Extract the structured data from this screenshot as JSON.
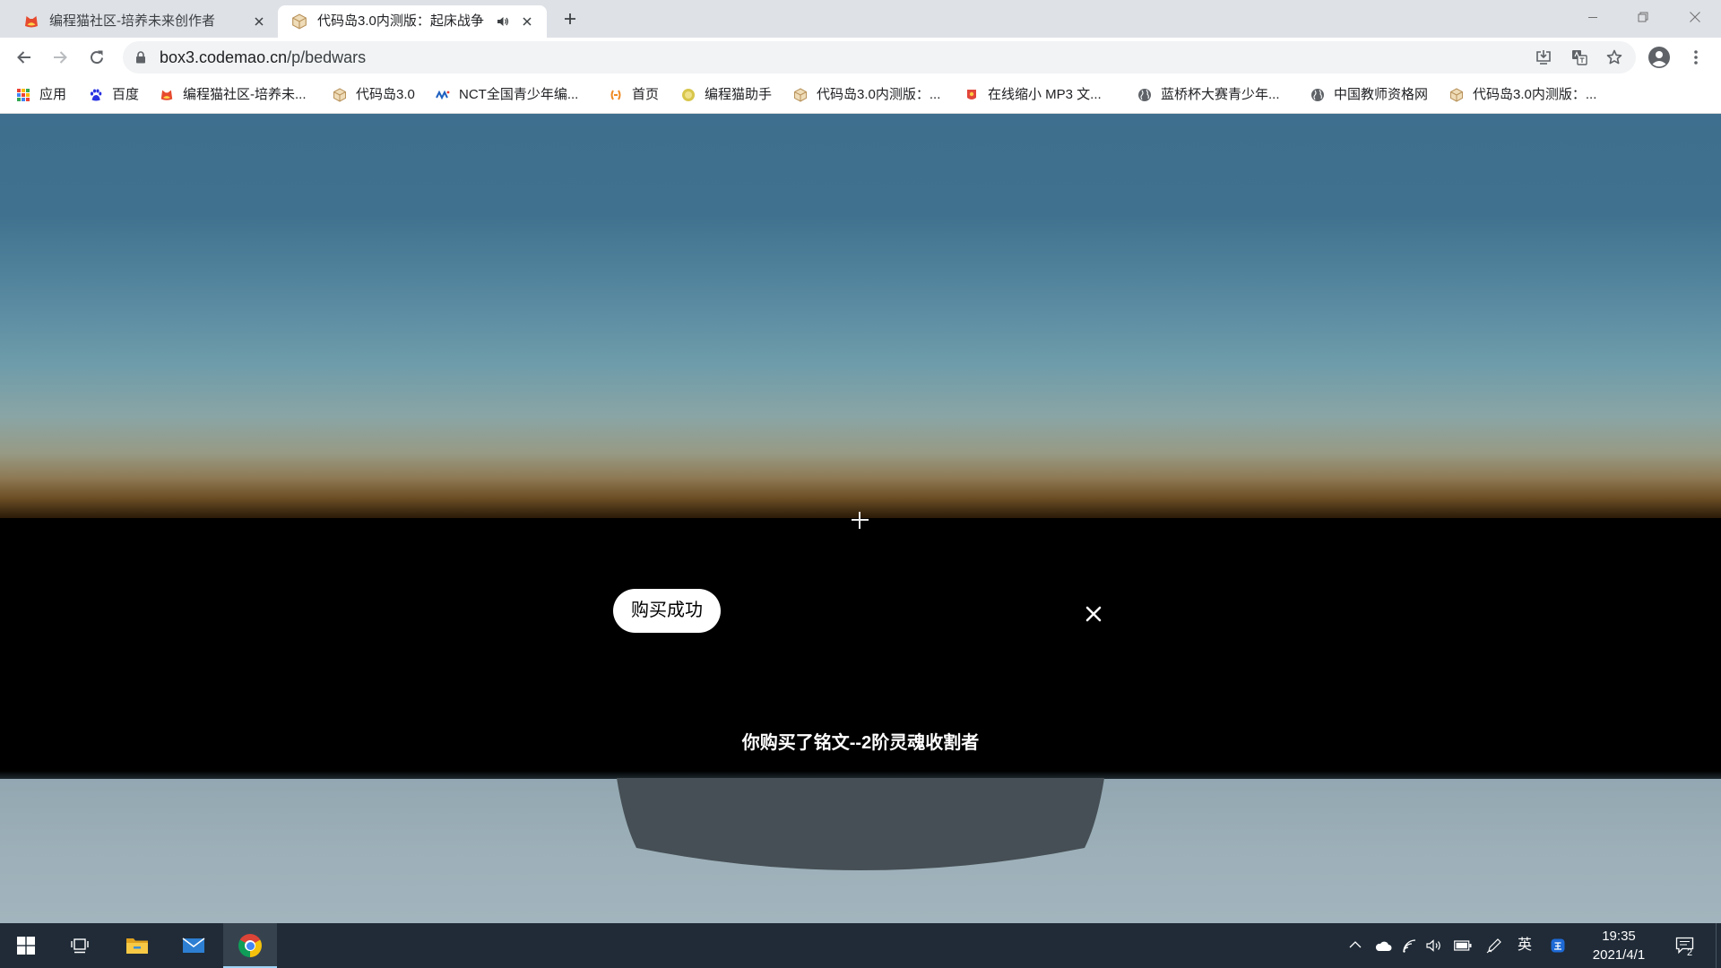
{
  "window": {
    "tabs": [
      {
        "title": "编程猫社区-培养未来创作者",
        "icon": "codemao-icon",
        "close_icon": "close-tab-icon"
      },
      {
        "title": "代码岛3.0内测版：起床战争",
        "icon": "box3-icon",
        "audio_icon": "speaker-icon",
        "close_icon": "close-tab-icon",
        "active": true
      }
    ],
    "controls": [
      "new-tab-icon",
      "minimize-icon",
      "restore-icon",
      "close-window-icon"
    ]
  },
  "toolbar": {
    "nav_icons": [
      "back-arrow-icon",
      "forward-arrow-icon",
      "reload-icon"
    ],
    "address": {
      "host": "box3.codemao.cn",
      "path": "/p/bedwars",
      "security_icon": "lock-icon"
    },
    "action_icons": [
      "install-app-icon",
      "translate-icon",
      "star-icon",
      "profile-avatar-icon",
      "more-menu-icon"
    ]
  },
  "bookmarks": [
    {
      "label": "应用",
      "icon": "apps-grid-icon"
    },
    {
      "label": "百度",
      "icon": "baidu-paw-icon"
    },
    {
      "label": "编程猫社区-培养未...",
      "icon": "codemao-icon"
    },
    {
      "label": "代码岛3.0",
      "icon": "box3-icon"
    },
    {
      "label": "NCT全国青少年编...",
      "icon": "nct-icon"
    },
    {
      "label": "首页",
      "icon": "bracket-logo-icon"
    },
    {
      "label": "编程猫助手",
      "icon": "codemao-helper-icon"
    },
    {
      "label": "代码岛3.0内测版：...",
      "icon": "box3-icon"
    },
    {
      "label": "在线缩小 MP3 文...",
      "icon": "mp3-compress-icon"
    },
    {
      "label": "蓝桥杯大赛青少年...",
      "icon": "globe-icon"
    },
    {
      "label": "中国教师资格网",
      "icon": "globe-icon"
    },
    {
      "label": "代码岛3.0内测版：...",
      "icon": "box3-icon"
    }
  ],
  "game": {
    "crosshair_icon": "crosshair-icon",
    "dialog": {
      "title": "购买成功",
      "close_icon": "close-icon",
      "message": "你购买了铭文--2阶灵魂收割者"
    }
  },
  "taskbar": {
    "pinned": [
      {
        "icon": "windows-start-icon"
      },
      {
        "icon": "task-view-icon"
      },
      {
        "icon": "file-explorer-icon"
      },
      {
        "icon": "mail-icon"
      },
      {
        "icon": "chrome-icon",
        "active": true
      }
    ],
    "tray": {
      "icons": [
        "show-hidden-icons-chevron-icon",
        "onedrive-cloud-icon",
        "network-icon",
        "volume-icon",
        "battery-icon",
        "pen-workspace-icon",
        "ime-app-icon"
      ],
      "ime_mode": "英",
      "time": "19:35",
      "date": "2021/4/1",
      "notification_icon": "action-center-icon",
      "notification_count": "2"
    }
  },
  "colors": {
    "tab_strip": "#dee1e6",
    "omnibox": "#f1f3f4",
    "sky_top": "#3e6f8e",
    "horizon_glow": "#8e7a55",
    "dialog_backdrop": "#000000",
    "ground": "#9baeb8",
    "taskbar": "#202b37",
    "chrome_active_underline": "#9fd3f5"
  }
}
